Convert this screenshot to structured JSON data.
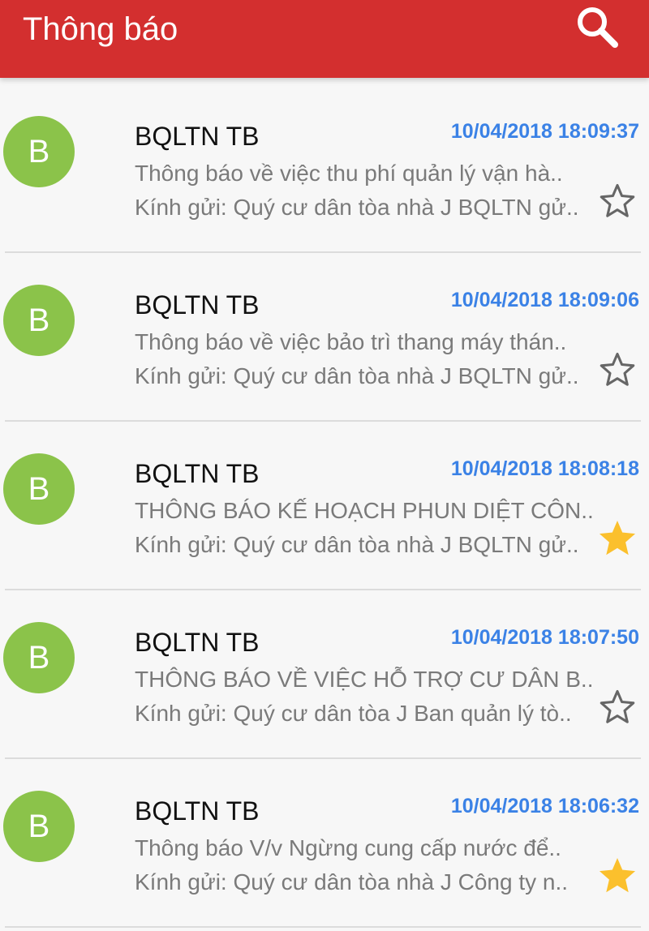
{
  "header": {
    "title": "Thông báo",
    "search_icon": "search-icon"
  },
  "colors": {
    "header_bg": "#d32f2f",
    "avatar_bg": "#8bc34a",
    "timestamp": "#3b82e6",
    "star_filled": "#fbc02d",
    "star_outline": "#666666"
  },
  "notifications": [
    {
      "avatar_letter": "B",
      "sender": "BQLTN TB",
      "timestamp": "10/04/2018 18:09:37",
      "subject": "Thông báo về việc thu phí quản lý vận hà..",
      "preview": "Kính gửi: Quý cư dân tòa nhà J BQLTN gử..",
      "starred": false
    },
    {
      "avatar_letter": "B",
      "sender": "BQLTN TB",
      "timestamp": "10/04/2018 18:09:06",
      "subject": "Thông báo về việc bảo trì thang máy thán..",
      "preview": "Kính gửi: Quý cư dân tòa nhà J BQLTN gử..",
      "starred": false
    },
    {
      "avatar_letter": "B",
      "sender": "BQLTN TB",
      "timestamp": "10/04/2018 18:08:18",
      "subject": "THÔNG BÁO KẾ HOẠCH PHUN DIỆT CÔN..",
      "preview": "Kính gửi: Quý cư dân tòa nhà J BQLTN gử..",
      "starred": true
    },
    {
      "avatar_letter": "B",
      "sender": "BQLTN TB",
      "timestamp": "10/04/2018 18:07:50",
      "subject": "THÔNG BÁO VỀ VIỆC HỖ TRỢ CƯ DÂN B..",
      "preview": "Kính gửi: Quý cư dân tòa J Ban quản lý tò..",
      "starred": false
    },
    {
      "avatar_letter": "B",
      "sender": "BQLTN TB",
      "timestamp": "10/04/2018 18:06:32",
      "subject": "Thông báo V/v Ngừng cung cấp nước để..",
      "preview": "Kính gửi: Quý cư dân tòa nhà J Công ty n..",
      "starred": true
    }
  ]
}
